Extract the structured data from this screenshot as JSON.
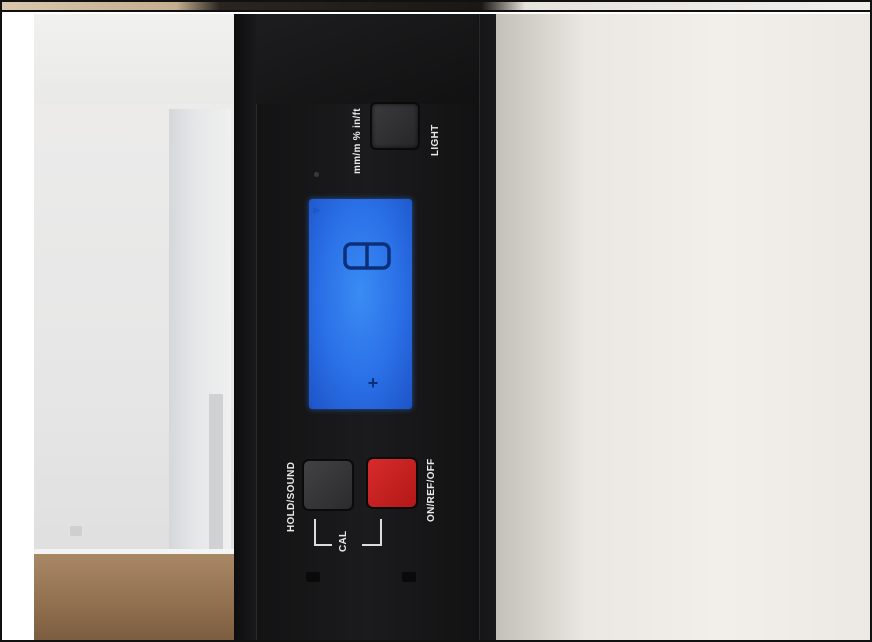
{
  "device": {
    "label_top_units": "mm/m % in/ft",
    "label_light": "LIGHT",
    "label_hold": "HOLD/SOUND",
    "label_cal": "CAL",
    "label_on": "ON/REF/OFF",
    "lcd": {
      "digit": "8",
      "indicator": "+",
      "colors": {
        "backlight": "#2a6fe6",
        "segment": "#0c2f7a"
      }
    },
    "buttons": {
      "light_color": "#2b2b2d",
      "hold_color": "#333335",
      "on_color": "#c62020"
    }
  }
}
